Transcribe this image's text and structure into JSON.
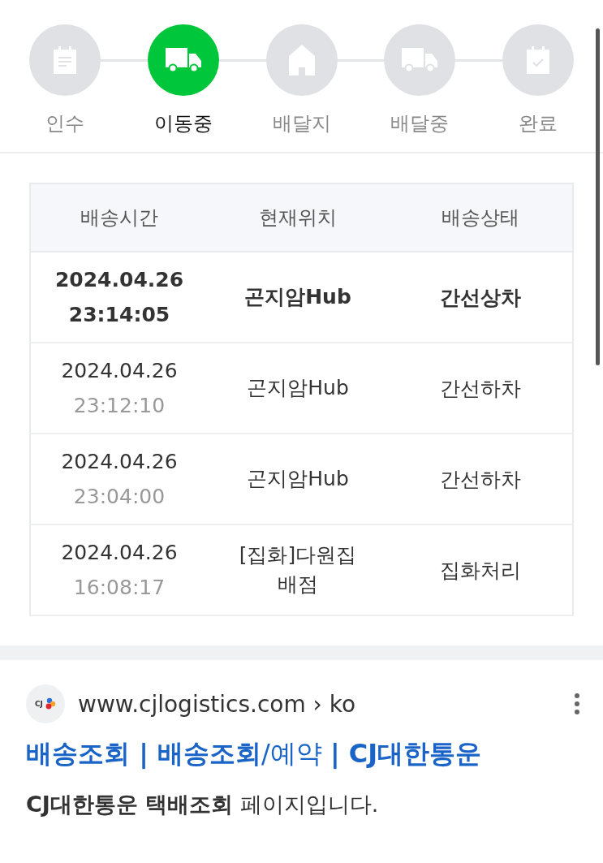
{
  "steps": [
    {
      "label": "인수",
      "kind": "clipboard",
      "selected": false
    },
    {
      "label": "이동중",
      "kind": "truck",
      "selected": true
    },
    {
      "label": "배달지",
      "kind": "house",
      "selected": false
    },
    {
      "label": "배달중",
      "kind": "truck",
      "selected": false
    },
    {
      "label": "완료",
      "kind": "calendar",
      "selected": false
    }
  ],
  "table": {
    "columns": [
      "배송시간",
      "현재위치",
      "배송상태"
    ],
    "rows": [
      {
        "date": "2024.04.26",
        "time": "23:14:05",
        "location": "곤지암Hub",
        "status": "간선상차",
        "latest": true
      },
      {
        "date": "2024.04.26",
        "time": "23:12:10",
        "location": "곤지암Hub",
        "status": "간선하차",
        "latest": false
      },
      {
        "date": "2024.04.26",
        "time": "23:04:00",
        "location": "곤지암Hub",
        "status": "간선하차",
        "latest": false
      },
      {
        "date": "2024.04.26",
        "time": "16:08:17",
        "location": "[집화]다원집 배점",
        "status": "집화처리",
        "latest": false
      }
    ]
  },
  "result": {
    "favicon": "CJ",
    "url": "www.cjlogistics.com › ko",
    "title": "**배송조회 | 배송조회**/예약 **| CJ대한통운**",
    "snippet": "**CJ대한통운 택배조회** 페이지입니다."
  }
}
